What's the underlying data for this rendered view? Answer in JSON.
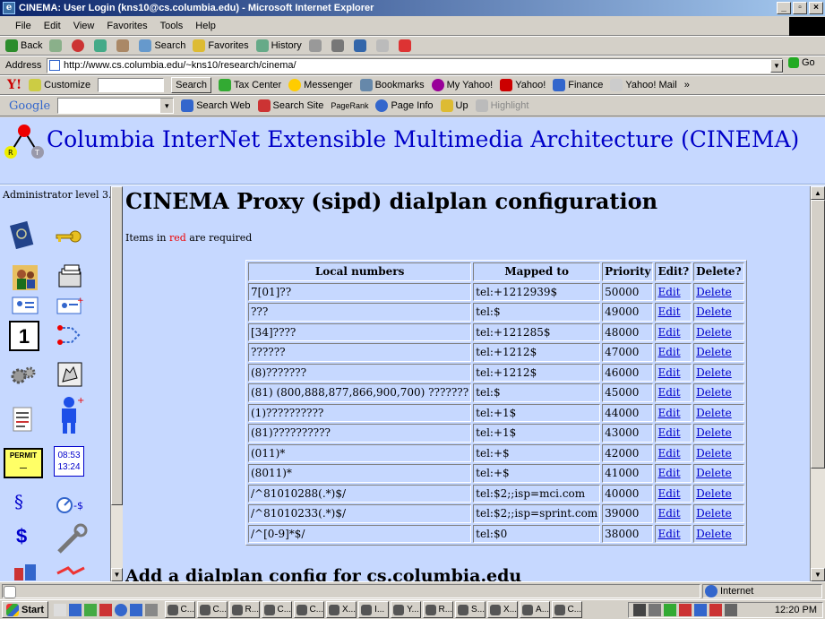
{
  "window": {
    "title": "CINEMA: User Login (kns10@cs.columbia.edu) - Microsoft Internet Explorer",
    "buttons": [
      "_",
      "▫",
      "×"
    ]
  },
  "menu": [
    "File",
    "Edit",
    "View",
    "Favorites",
    "Tools",
    "Help"
  ],
  "toolbar": {
    "back": "Back",
    "search": "Search",
    "favorites": "Favorites",
    "history": "History"
  },
  "address": {
    "label": "Address",
    "url": "http://www.cs.columbia.edu/~kns10/research/cinema/",
    "go": "Go"
  },
  "yahoo_bar": {
    "customize": "Customize",
    "search_button": "Search",
    "items": [
      "Tax Center",
      "Messenger",
      "Bookmarks",
      "My Yahoo!",
      "Yahoo!",
      "Finance",
      "Yahoo! Mail"
    ],
    "more": "»"
  },
  "google_bar": {
    "logo": "Google",
    "search_web": "Search Web",
    "search_site": "Search Site",
    "pagerank": "PageRank",
    "page_info": "Page Info",
    "up": "Up",
    "highlight": "Highlight"
  },
  "banner": {
    "title": "Columbia InterNet Extensible Multimedia Architecture (CINEMA)"
  },
  "leftnav": {
    "label": "Administrator level 3.",
    "calendar_day": "1",
    "clock_time_1": "08:53",
    "clock_time_2": "13:24",
    "permit": "PERMIT"
  },
  "main": {
    "page_title": "CINEMA Proxy (sipd) dialplan configuration",
    "help": "?",
    "req_note_pre": "Items in ",
    "req_note_red": "red",
    "req_note_post": " are required",
    "add_title": "Add a dialplan config for cs.columbia.edu"
  },
  "table": {
    "headers": [
      "Local numbers",
      "Mapped to",
      "Priority",
      "Edit?",
      "Delete?"
    ],
    "rows": [
      {
        "local": "7[01]??",
        "mapped": "tel:+1212939$",
        "priority": "50000",
        "edit": "Edit",
        "delete": "Delete"
      },
      {
        "local": "???",
        "mapped": "tel:$",
        "priority": "49000",
        "edit": "Edit",
        "delete": "Delete"
      },
      {
        "local": "[34]????",
        "mapped": "tel:+121285$",
        "priority": "48000",
        "edit": "Edit",
        "delete": "Delete"
      },
      {
        "local": "??????",
        "mapped": "tel:+1212$",
        "priority": "47000",
        "edit": "Edit",
        "delete": "Delete"
      },
      {
        "local": "(8)???????",
        "mapped": "tel:+1212$",
        "priority": "46000",
        "edit": "Edit",
        "delete": "Delete"
      },
      {
        "local": "(81) (800,888,877,866,900,700) ???????",
        "mapped": "tel:$",
        "priority": "45000",
        "edit": "Edit",
        "delete": "Delete"
      },
      {
        "local": "(1)??????????",
        "mapped": "tel:+1$",
        "priority": "44000",
        "edit": "Edit",
        "delete": "Delete"
      },
      {
        "local": "(81)??????????",
        "mapped": "tel:+1$",
        "priority": "43000",
        "edit": "Edit",
        "delete": "Delete"
      },
      {
        "local": "(011)*",
        "mapped": "tel:+$",
        "priority": "42000",
        "edit": "Edit",
        "delete": "Delete"
      },
      {
        "local": "(8011)*",
        "mapped": "tel:+$",
        "priority": "41000",
        "edit": "Edit",
        "delete": "Delete"
      },
      {
        "local": "/^81010288(.*)$/",
        "mapped": "tel:$2;;isp=mci.com",
        "priority": "40000",
        "edit": "Edit",
        "delete": "Delete"
      },
      {
        "local": "/^81010233(.*)$/",
        "mapped": "tel:$2;;isp=sprint.com",
        "priority": "39000",
        "edit": "Edit",
        "delete": "Delete"
      },
      {
        "local": "/^[0-9]*$/",
        "mapped": "tel:$0",
        "priority": "38000",
        "edit": "Edit",
        "delete": "Delete"
      }
    ]
  },
  "status": {
    "zone": "Internet"
  },
  "taskbar": {
    "start": "Start",
    "tasks": [
      "C...",
      "C...",
      "R...",
      "C...",
      "C...",
      "X...",
      "I...",
      "Y...",
      "R...",
      "S...",
      "X...",
      "A...",
      "C..."
    ],
    "clock": "12:20 PM"
  }
}
